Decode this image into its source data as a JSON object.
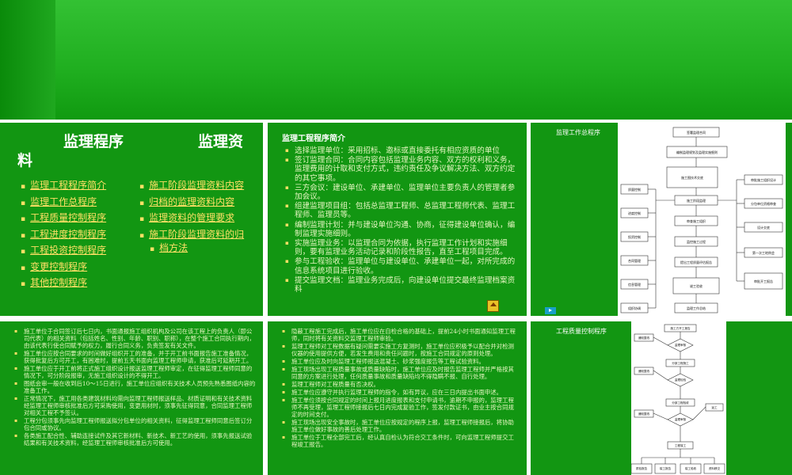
{
  "slide1": {
    "title_part1": "监理程序",
    "title_part2": "监理资",
    "title_part3": "料",
    "left_links": [
      "监理工程程序简介",
      "监理工作总程序",
      "工程质量控制程序",
      "工程进度控制程序",
      "工程投资控制程序",
      "变更控制程序",
      "其他控制程序"
    ],
    "right_links": [
      "施工阶段监理资料内容",
      "归档的监理资料内容",
      "监理资料的管理要求",
      "施工阶段监理资料的归",
      "档方法"
    ]
  },
  "slide2": {
    "title": "监理工程程序简介",
    "bullets": [
      "选择监理单位：采用招标、邀标或直接委托有相应资质的单位",
      "签订监理合同：合同内容包括监理业务内容、双方的权利和义务，监理费用的计取和支付方式，违约责任及争议解决方法、双方约定的其它事项。",
      "三方会议：建设单位、承建单位、监理单位主要负责人的管理者参加会议。",
      "组建监理项目组：包括总监理工程师、总监理工程师代表、监理工程师、监理员等。",
      "编制监理计划：并与建设单位沟通、协商，征得建设单位确认，编制监理实施细则。",
      "实施监理业务：以监理合同为依据，执行监理工作计划和实施细则，要有监理业务活动记录和阶段性报告，直至工程项目完成。",
      "参与工程验收：监理单位与建设单位、承建单位一起，对所完成的信息系统项目进行验收。",
      "提交监理文档：监理业务完成后，向建设单位提交最终监理档案资料"
    ]
  },
  "slide3": {
    "title": "监理工作总程序",
    "flow_main": [
      "签署监理合同",
      "编制监理规划及监理实施细则",
      "施工图技术交底",
      "施工阶段监理",
      "审查施工组织",
      "监控施工过程",
      "提出工程质量评估报告",
      "竣工验收",
      "监理工作总结"
    ],
    "flow_left": [
      "质量控制",
      "进度控制",
      "投资控制",
      "合同管理",
      "信息管理",
      "组织协调"
    ],
    "flow_right": [
      "审批施工组织设计",
      "分包单位资格审查",
      "设计交底",
      "第一次工地例会",
      "审批开工报告"
    ]
  },
  "slide4": {
    "bullets": [
      "施工单位于合同签订后七日内，书面通报施工组织机构及公司在该工程上的负责人（即公司代表）的相关资料（包括姓名、性别、年龄、职别、职称），在整个施工合同执行期内，由该代表行使合同赋予的权力，履行合同义务，负责签发有关文件。",
      "施工单位应按合同要求的时间做好组织开工的准备，并于开工前书面报告施工准备情况，获得批复后方可开工，有困难时，提前五天书面向监理工程师申请，获准后可延期开工。",
      "施工单位应于开工前将正式施工组织设计报送监理工程师审定，在征得监理工程师同意的情况下，可分阶段报审，无施工组织设计的不得开工。",
      "图纸会审一般在收到后10～15日进行，施工单位应组织有关技术人员预先熟悉图纸内容的准备工作。",
      "正常情况下，施工用各类建筑材料均需向监理工程师报送样品、材质证明和有关技术资料经监理工程师审核批准后方可采购使用，变更用材时，须事先征得同意，合同监理工程师对相关工程不予签认。",
      "工程分包须事先向监理工程师报送拟分包单位的相关资料，征得监理工程师同意后签订分包合同或协议。",
      "各类施工配合性、辅助连接试件及其它新材料、新技术、新工艺的使用，须事先报送试验结果和有关技术资料，经监理工程师审核批准后方可使用。"
    ]
  },
  "slide5": {
    "bullets": [
      "隐蔽工程施工完成后，施工单位应在自检合格的基础上，提前24小时书面通知监理工程师，同时将有关资料交监理工程师审验。",
      "监理工程师对工程数据有疑问需要实施工方复测时，施工单位应积极予以配合并对检测仪器的使用提供方便，若发生费用和责任问题时，按施工合同规定的原则处理。",
      "施工单位应及时向监理工程师报送混凝土、砂浆强度报告等工程试验资料。",
      "施工现场出现工程质量事故或质量缺陷时，施工单位应及时报告监理工程师并严格按其同意的方案进行处理，任何质量事故和质量缺陷均不得隐瞒不报、自行处理。",
      "监理工程师对工程质量有否决权。",
      "施工单位应遵守并执行监理工程师的指令，如有异议，应在三日内提出书面申述。",
      "施工单位须按合同规定的时间上报月进度报表和支付申请书，逾期不申报的，监理工程师不再受理，监理工程师接报后七日内完成复验工作，签发付款证书，由业主按合同规定的时间支付。",
      "施工现场出现安全事故时，施工单位应按规定的程序上报，监理工程师接报后，将协助施工单位做好事故的善后处理工作。",
      "施工单位于工程全部完工后，经认真自检认为符合交工条件时，可向监理工程师提交工程竣工报告。"
    ]
  },
  "slide6": {
    "title": "工程质量控制程序",
    "flow_main": [
      "施工方开工报告",
      "监理审核",
      "分部工程施工",
      "监理检验",
      "分部工程验收",
      "监理审核",
      "工程竣工",
      "竣工验收"
    ],
    "flow_side": [
      "通知整改",
      "提出",
      "通知整改",
      "返工",
      "通知整改",
      "不合格"
    ],
    "flow_bottom": [
      "质检报告",
      "竣工报告",
      "竣工验收",
      "资料移交"
    ],
    "flow_labels": [
      "N",
      "Y",
      "N",
      "Y",
      "N",
      "Y"
    ]
  },
  "colors": {
    "slide_bg": "#129612",
    "link": "#ffe066",
    "text": "#e4f6c0"
  }
}
